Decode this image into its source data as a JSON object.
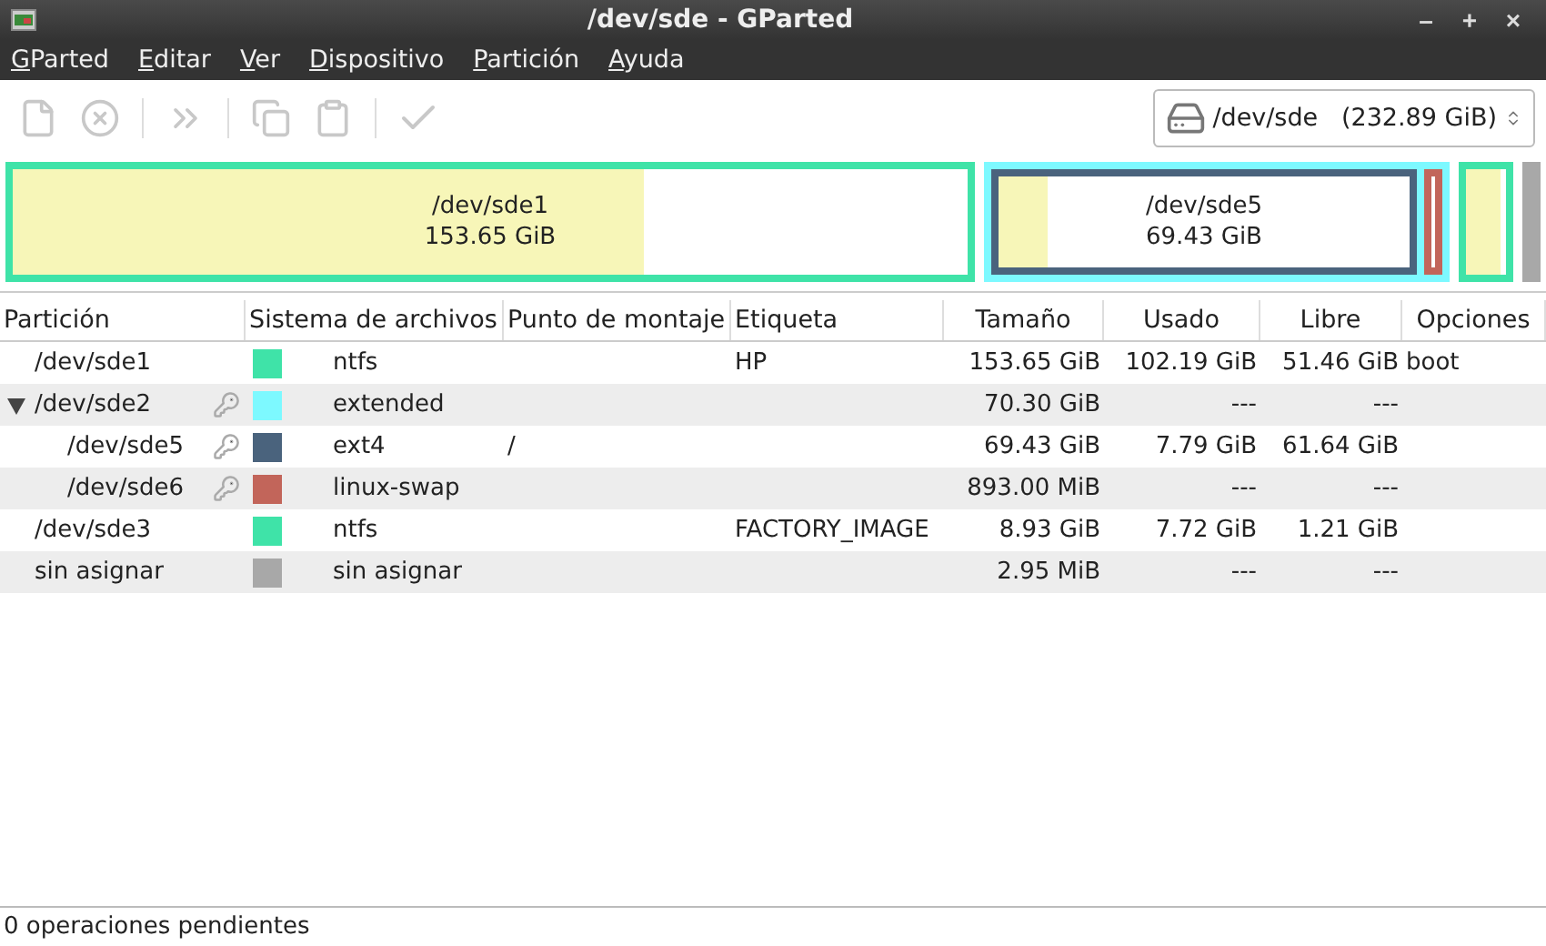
{
  "window": {
    "title": "/dev/sde - GParted",
    "controls": [
      "–",
      "+",
      "×"
    ]
  },
  "menu": [
    "GParted",
    "Editar",
    "Ver",
    "Dispositivo",
    "Partición",
    "Ayuda"
  ],
  "toolbar": [
    {
      "kind": "new",
      "disabled": true
    },
    {
      "kind": "delete",
      "disabled": true
    },
    {
      "kind": "sep"
    },
    {
      "kind": "resize",
      "disabled": true
    },
    {
      "kind": "sep"
    },
    {
      "kind": "copy",
      "disabled": true
    },
    {
      "kind": "paste",
      "disabled": true
    },
    {
      "kind": "sep"
    },
    {
      "kind": "apply",
      "disabled": true
    }
  ],
  "device": {
    "label": "/dev/sde   (232.89 GiB)"
  },
  "disk_map": [
    {
      "kind": "partition",
      "name": "/dev/sde1",
      "size": "153.65 GiB",
      "color": "#3fe3a8",
      "level": 0.66
    },
    {
      "kind": "extended",
      "color": "#7df9ff",
      "children": [
        {
          "kind": "partition",
          "name": "/dev/sde5",
          "size": "69.43 GiB",
          "color": "#4a637d",
          "level": 0.12
        },
        {
          "kind": "partition",
          "color": "#c2655a"
        }
      ]
    },
    {
      "kind": "partition",
      "color": "#3fe3a8",
      "level": 0.86
    },
    {
      "kind": "unallocated",
      "color": "#a8a8a8"
    }
  ],
  "table": {
    "columns": [
      "Partición",
      "Sistema de archivos",
      "Punto de montaje",
      "Etiqueta",
      "Tamaño",
      "Usado",
      "Libre",
      "Opciones"
    ],
    "rows": [
      {
        "partition": "/dev/sde1",
        "locked": false,
        "color": "#3fe3a8",
        "filesystem": "ntfs",
        "label": "HP",
        "size": "153.65 GiB",
        "used": "102.19 GiB",
        "free": "51.46 GiB",
        "flags": "boot"
      },
      {
        "partition": "/dev/sde2",
        "locked": true,
        "expanded": true,
        "color": "#7df9ff",
        "filesystem": "extended",
        "size": "70.30 GiB",
        "used": "---",
        "free": "---",
        "children": [
          {
            "partition": "/dev/sde5",
            "locked": true,
            "color": "#4a637d",
            "filesystem": "ext4",
            "mount": "/",
            "size": "69.43 GiB",
            "used": "7.79 GiB",
            "free": "61.64 GiB"
          },
          {
            "partition": "/dev/sde6",
            "locked": true,
            "color": "#c2655a",
            "filesystem": "linux-swap",
            "size": "893.00 MiB",
            "used": "---",
            "free": "---"
          }
        ]
      },
      {
        "partition": "/dev/sde3",
        "locked": false,
        "color": "#3fe3a8",
        "filesystem": "ntfs",
        "label": "FACTORY_IMAGE",
        "size": "8.93 GiB",
        "used": "7.72 GiB",
        "free": "1.21 GiB"
      },
      {
        "partition": "sin asignar",
        "locked": false,
        "color": "#a8a8a8",
        "filesystem": "sin asignar",
        "size": "2.95 MiB",
        "used": "---",
        "free": "---"
      }
    ]
  },
  "status_bar": "0 operaciones pendientes"
}
